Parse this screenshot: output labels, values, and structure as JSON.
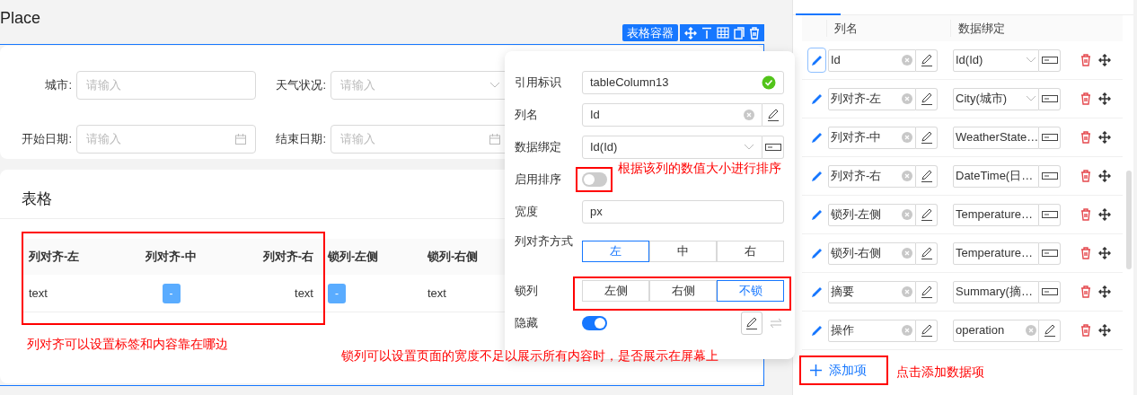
{
  "canvas": {
    "title": "Place",
    "container_label": "表格容器"
  },
  "search_form": {
    "fields": [
      {
        "label": "城市:",
        "placeholder": "请输入",
        "kind": "text"
      },
      {
        "label": "天气状况:",
        "placeholder": "请输入",
        "kind": "select"
      },
      {
        "label": "开始日期:",
        "placeholder": "请输入",
        "kind": "date"
      },
      {
        "label": "结束日期:",
        "placeholder": "请输入",
        "kind": "date"
      }
    ]
  },
  "table_card": {
    "title": "表格",
    "columns": [
      {
        "label": "列对齐-左",
        "kind": "left"
      },
      {
        "label": "列对齐-中",
        "kind": "center"
      },
      {
        "label": "列对齐-右",
        "kind": "right"
      },
      {
        "label": "锁列-左侧",
        "kind": "left"
      },
      {
        "label": "锁列-右侧",
        "kind": "left"
      }
    ],
    "row": [
      {
        "kind": "text",
        "text": "text"
      },
      {
        "kind": "tag",
        "text": "-"
      },
      {
        "kind": "text",
        "text": "text"
      },
      {
        "kind": "tag",
        "text": "-"
      },
      {
        "kind": "text",
        "text": "text"
      }
    ]
  },
  "popover": {
    "rows": [
      {
        "kind": "ref",
        "label": "引用标识",
        "value": "tableColumn13"
      },
      {
        "kind": "name",
        "label": "列名",
        "value": "Id"
      },
      {
        "kind": "binding",
        "label": "数据绑定",
        "value": "Id(Id)"
      },
      {
        "kind": "switch",
        "label": "启用排序",
        "on": false
      },
      {
        "kind": "width",
        "label": "宽度",
        "suffix": "px"
      },
      {
        "kind": "segmented",
        "label": "列对齐方式",
        "options": [
          {
            "label": "左",
            "selected": true
          },
          {
            "label": "中",
            "selected": false
          },
          {
            "label": "右",
            "selected": false
          }
        ]
      },
      {
        "kind": "segmented",
        "label": "锁列",
        "options": [
          {
            "label": "左侧",
            "selected": false
          },
          {
            "label": "右侧",
            "selected": false
          },
          {
            "label": "不锁",
            "selected": true
          }
        ]
      },
      {
        "kind": "switch_tools",
        "label": "隐藏",
        "on": true
      }
    ]
  },
  "column_list": {
    "headers": [
      "列名",
      "数据绑定"
    ],
    "rows": [
      {
        "name": "Id",
        "binding": "Id(Id)",
        "kind": "select",
        "selected": true
      },
      {
        "name": "列对齐-左",
        "binding": "City(城市)",
        "kind": "select",
        "selected": false
      },
      {
        "name": "列对齐-中",
        "binding": "WeatherState…",
        "kind": "truncated",
        "selected": false
      },
      {
        "name": "列对齐-右",
        "binding": "DateTime(日…",
        "kind": "truncated",
        "selected": false
      },
      {
        "name": "锁列-左侧",
        "binding": "Temperature…",
        "kind": "truncated",
        "selected": false
      },
      {
        "name": "锁列-右侧",
        "binding": "Temperature…",
        "kind": "truncated",
        "selected": false
      },
      {
        "name": "摘要",
        "binding": "Summary(摘…",
        "kind": "truncated",
        "selected": false
      },
      {
        "name": "操作",
        "binding": "operation",
        "kind": "text",
        "selected": false
      }
    ],
    "add_label": "添加项"
  },
  "annotations": [
    {
      "kind": "align",
      "text": "列对齐可以设置标签和内容靠在哪边"
    },
    {
      "kind": "lock",
      "text": "锁列可以设置页面的宽度不足以展示所有内容时，是否展示在屏幕上"
    },
    {
      "kind": "sort",
      "text": "根据该列的数值大小进行排序"
    },
    {
      "kind": "add",
      "text": "点击添加数据项"
    }
  ]
}
